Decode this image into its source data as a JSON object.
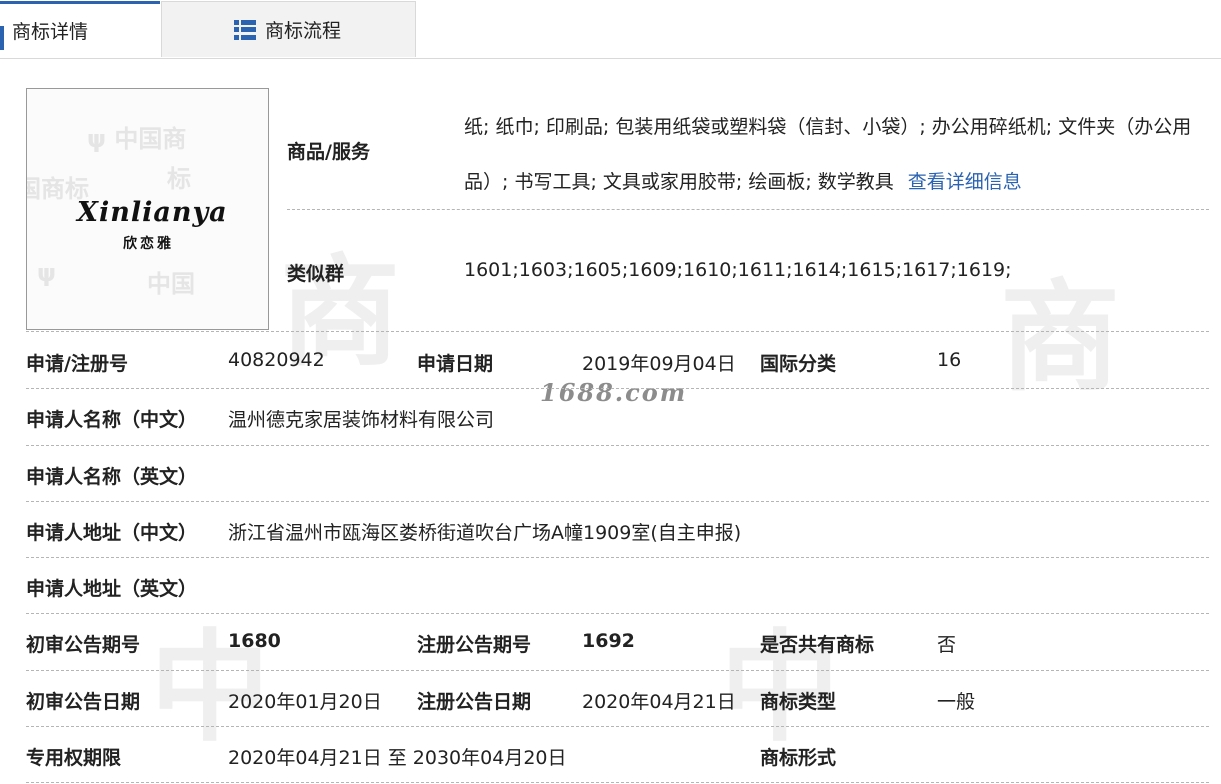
{
  "tabs": [
    {
      "label": "商标详情"
    },
    {
      "label": "商标流程"
    }
  ],
  "logo": {
    "text": "Xinlianya",
    "chinese": "欣恋雅"
  },
  "watermark_text": "1688.com",
  "goods_services": {
    "label": "商品/服务",
    "text": "纸; 纸巾; 印刷品; 包装用纸袋或塑料袋（信封、小袋）; 办公用碎纸机; 文件夹（办公用品）; 书写工具; 文具或家用胶带; 绘画板; 数学教具",
    "link": "查看详细信息"
  },
  "similar_group": {
    "label": "类似群",
    "value": "1601;1603;1605;1609;1610;1611;1614;1615;1617;1619;"
  },
  "fields": {
    "reg_no_label": "申请/注册号",
    "reg_no": "40820942",
    "apply_date_label": "申请日期",
    "apply_date": "2019年09月04日",
    "intl_class_label": "国际分类",
    "intl_class": "16",
    "applicant_cn_label": "申请人名称（中文）",
    "applicant_cn": "温州德克家居装饰材料有限公司",
    "applicant_en_label": "申请人名称（英文）",
    "applicant_en": "",
    "address_cn_label": "申请人地址（中文）",
    "address_cn": "浙江省温州市瓯海区娄桥街道吹台广场A幢1909室(自主申报)",
    "address_en_label": "申请人地址（英文）",
    "address_en": "",
    "prelim_no_label": "初审公告期号",
    "prelim_no": "1680",
    "reg_pub_no_label": "注册公告期号",
    "reg_pub_no": "1692",
    "shared_label": "是否共有商标",
    "shared": "否",
    "prelim_date_label": "初审公告日期",
    "prelim_date": "2020年01月20日",
    "reg_pub_date_label": "注册公告日期",
    "reg_pub_date": "2020年04月21日",
    "tm_type_label": "商标类型",
    "tm_type": "一般",
    "term_label": "专用权期限",
    "term": "2020年04月21日 至 2030年04月20日",
    "tm_form_label": "商标形式",
    "tm_form": ""
  },
  "colors": {
    "accent": "#2b63b1",
    "link": "#2b63b1",
    "divider": "#b5b5b5"
  }
}
